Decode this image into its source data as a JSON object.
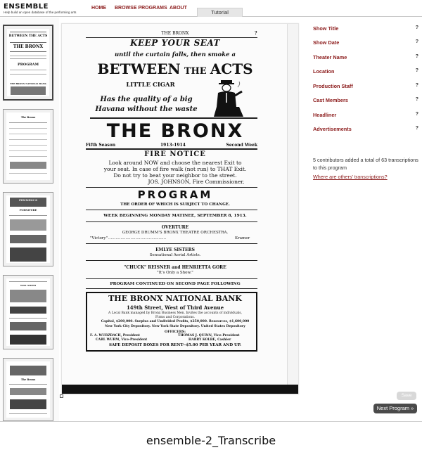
{
  "header": {
    "brand": "ENSEMBLE",
    "tagline": "Help build an open database of the performing arts",
    "nav": [
      "HOME",
      "BROWSE PROGRAMS",
      "ABOUT"
    ],
    "tab": "Tutorial"
  },
  "thumbnails": [
    {
      "title_top": "BETWEEN THE ACTS",
      "title_mid": "THE BRONX",
      "title_low": "PROGRAM",
      "title_bank": "THE BRONX NATIONAL BANK"
    },
    {
      "heading": "The Bronx"
    },
    {
      "heading": "FENNELL'S",
      "sub": "FURNITURE"
    },
    {
      "heading": "WILL SMITH"
    },
    {
      "heading": "The Bronx"
    }
  ],
  "document": {
    "running_head": "THE BRONX",
    "running_q": "?",
    "ad_line1": "KEEP YOUR SEAT",
    "ad_line2": "until the curtain falls, then smoke a",
    "ad_line3_a": "BETWEEN",
    "ad_line3_b": "THE",
    "ad_line3_c": "ACTS",
    "ad_line4": "LITTLE CIGAR",
    "ad_line5": "Has the quality of a big",
    "ad_line6": "Havana without the waste",
    "theater": "THE BRONX",
    "season_left": "Fifth Season",
    "season_mid": "1913-1914",
    "season_right": "Second Week",
    "fire_title": "FIRE NOTICE",
    "fire_1": "Look around NOW and choose the nearest Exit to",
    "fire_2": "your seat.  In case of fire walk (not run) to THAT Exit.",
    "fire_3": "Do not try to beat your neighbor to the street.",
    "fire_4": "JOS. JOHNSON, Fire Commissioner.",
    "program": "PROGRAM",
    "order": "THE ORDER OF WHICH IS SUBJECT TO CHANGE.",
    "week": "WEEK BEGINNING MONDAY MATINEE, SEPTEMBER 8, 1913.",
    "overture": "OVERTURE",
    "orchestra": "GEORGE DRUMM'S BRONX THEATRE ORCHESTRA.",
    "victory_left": "\"Victory\"",
    "victory_dots": "...............................................",
    "victory_right": "Kramer",
    "act1_name": "EMLYE SISTERS",
    "act1_desc": "Sensational Aerial Artists.",
    "act2_name": "\"CHUCK\" REISNER and HENRIETTA GORE",
    "act2_desc": "\"It's Only a Show.\"",
    "continued": "PROGRAM CONTINUED ON SECOND PAGE FOLLOWING",
    "bank_title": "THE BRONX NATIONAL BANK",
    "bank_addr": "149th Street, West of Third Avenue",
    "bank_l1": "A Local Bank managed by Bronx Business Men.  Invites the accounts of individuals,",
    "bank_l2": "Firms and Corporations.",
    "bank_l3": "Capital, $200,000.   Surplus and Undivided Profits, $250,000.   Resources, $1,600,000",
    "bank_l4": "New York City Depository.     New York State Depository.     United States Depository",
    "officers": "OFFICERS:",
    "off1_left": "F. A. WURZBACH, President",
    "off1_right": "THOMAS J. QUINN, Vice-President",
    "off2_left": "CARL WURM, Vice-President",
    "off2_right": "HARRY KOLBE, Cashier",
    "bank_safe": "SAFE DEPOSIT BOXES FOR RENT--$5.00 PER YEAR AND UP."
  },
  "fields": [
    {
      "label": "Show Title",
      "help": "?"
    },
    {
      "label": "Show Date",
      "help": "?"
    },
    {
      "label": "Theater Name",
      "help": "?"
    },
    {
      "label": "Location",
      "help": "?"
    },
    {
      "label": "Production Staff",
      "help": "?"
    },
    {
      "label": "Cast Members",
      "help": "?"
    },
    {
      "label": "Headliner",
      "help": "?"
    },
    {
      "label": "Advertisements",
      "help": "?"
    }
  ],
  "contributors_text": "5 contributors added a total of 63 transcriptions to this program",
  "others_link": "Where are others' transcriptions?",
  "save_label": "Save",
  "next_label": "Next Program »",
  "caption": "ensemble-2_Transcribe"
}
